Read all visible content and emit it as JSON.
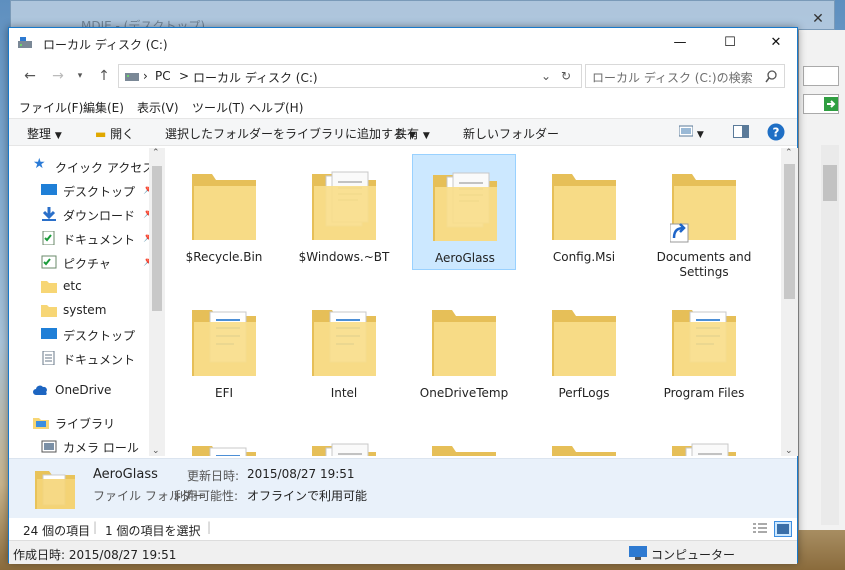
{
  "background_window": {
    "title": "MDIE - (デスクトップ)"
  },
  "window": {
    "title": "ローカル ディスク (C:)",
    "accent": "#1979ca"
  },
  "address": {
    "crumbs": [
      "PC",
      ">",
      "ローカル ディスク (C:)"
    ],
    "search_placeholder": "ローカル ディスク (C:)の検索"
  },
  "menu": [
    "ファイル(F)",
    "編集(E)",
    "表示(V)",
    "ツール(T)",
    "ヘルプ(H)"
  ],
  "commands": {
    "organize": "整理",
    "open": "開く",
    "add_to_library": "選択したフォルダーをライブラリに追加する",
    "share": "共有",
    "new_folder": "新しいフォルダー"
  },
  "nav": [
    {
      "label": "クイック アクセス",
      "icon": "star-icon"
    },
    {
      "label": "デスクトップ",
      "icon": "desktop-icon",
      "pinned": true
    },
    {
      "label": "ダウンロード",
      "icon": "download-icon",
      "pinned": true
    },
    {
      "label": "ドキュメント",
      "icon": "document-icon",
      "pinned": true
    },
    {
      "label": "ピクチャ",
      "icon": "picture-icon",
      "pinned": true
    },
    {
      "label": "etc",
      "icon": "folder-icon"
    },
    {
      "label": "system",
      "icon": "folder-icon"
    },
    {
      "label": "デスクトップ",
      "icon": "desktop-icon"
    },
    {
      "label": "ドキュメント",
      "icon": "document-icon"
    },
    {
      "label": "OneDrive",
      "icon": "cloud-icon"
    },
    {
      "label": "ライブラリ",
      "icon": "library-icon"
    },
    {
      "label": "カメラ ロール",
      "icon": "camera-roll-icon"
    }
  ],
  "files": [
    {
      "name": "$Recycle.Bin",
      "kind": "empty"
    },
    {
      "name": "$Windows.~BT",
      "kind": "docs"
    },
    {
      "name": "AeroGlass",
      "kind": "docs",
      "selected": true
    },
    {
      "name": "Config.Msi",
      "kind": "empty"
    },
    {
      "name": "Documents and Settings",
      "kind": "shortcut"
    },
    {
      "name": "EFI",
      "kind": "blue"
    },
    {
      "name": "Intel",
      "kind": "blue"
    },
    {
      "name": "OneDriveTemp",
      "kind": "empty"
    },
    {
      "name": "PerfLogs",
      "kind": "empty"
    },
    {
      "name": "Program Files",
      "kind": "blue"
    },
    {
      "name": "",
      "kind": "blue"
    },
    {
      "name": "",
      "kind": "docs"
    },
    {
      "name": "",
      "kind": "empty"
    },
    {
      "name": "",
      "kind": "empty"
    },
    {
      "name": "",
      "kind": "docs"
    }
  ],
  "details": {
    "name": "AeroGlass",
    "type": "ファイル フォルダー",
    "modified_label": "更新日時:",
    "modified_value": "2015/08/27 19:51",
    "availability_label": "利用可能性:",
    "availability_value": "オフラインで利用可能"
  },
  "status": {
    "count": "24 個の項目",
    "selected": "1 個の項目を選択"
  },
  "info": {
    "created": "作成日時: 2015/08/27 19:51",
    "location": "コンピューター"
  }
}
